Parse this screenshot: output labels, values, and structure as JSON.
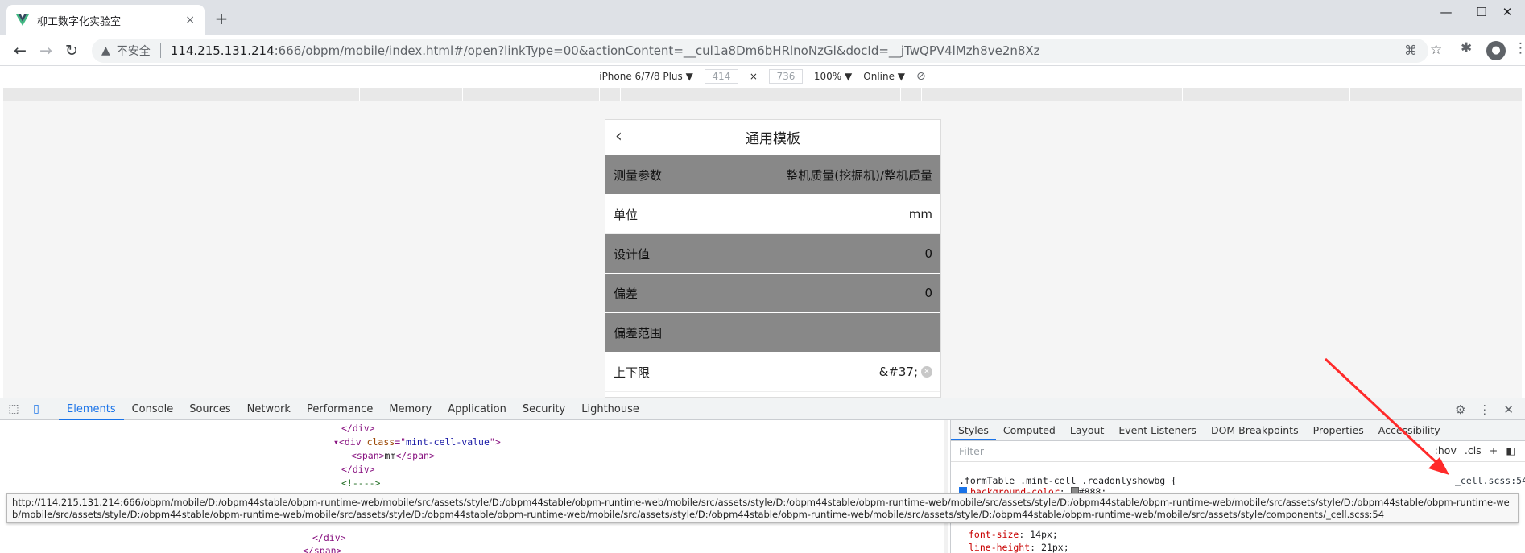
{
  "browser": {
    "tab_title": "柳工数字化实验室",
    "tab_close": "×",
    "new_tab": "+",
    "win_min": "—",
    "win_max": "☐",
    "win_close": "✕",
    "insecure_label": "不安全",
    "url_host": "114.215.131.214",
    "url_rest": ":666/obpm/mobile/index.html#/open?linkType=00&actionContent=__cul1a8Dm6bHRlnoNzGl&docId=__jTwQPV4lMzh8ve2n8Xz"
  },
  "device_toolbar": {
    "device": "iPhone 6/7/8 Plus ▼",
    "width": "414",
    "times": "×",
    "height": "736",
    "zoom": "100% ▼",
    "network": "Online ▼"
  },
  "page": {
    "title": "通用模板",
    "rows": [
      {
        "label": "测量参数",
        "value": "整机质量(挖掘机)/整机质量"
      },
      {
        "label": "单位",
        "value": "mm"
      },
      {
        "label": "设计值",
        "value": "0"
      },
      {
        "label": "偏差",
        "value": "0"
      },
      {
        "label": "偏差范围",
        "value": ""
      },
      {
        "label": "上下限",
        "value": "&#37;"
      }
    ]
  },
  "devtools": {
    "tabs": [
      "Elements",
      "Console",
      "Sources",
      "Network",
      "Performance",
      "Memory",
      "Application",
      "Security",
      "Lighthouse"
    ],
    "elements": {
      "line1_close": "</div>",
      "line2_tag_open": "<div ",
      "line2_attr": "class",
      "line2_eq": "=\"",
      "line2_val": "mint-cell-value",
      "line2_end": "\">",
      "line3_open": "<span>",
      "line3_text": "mm",
      "line3_close": "</span>",
      "line4_close": "</div>",
      "line5_comment": "<!---->",
      "line6_close": "</div>",
      "line7_close": "</span>"
    },
    "styles_tabs": [
      "Styles",
      "Computed",
      "Layout",
      "Event Listeners",
      "DOM Breakpoints",
      "Properties",
      "Accessibility"
    ],
    "filter_placeholder": "Filter",
    "filter_hov": ":hov",
    "filter_cls": ".cls",
    "filter_plus": "+",
    "selector": ".formTable .mint-cell .readonlyshowbg {",
    "source": "_cell.scss:54",
    "prop_bg": "background-color",
    "prop_bg_val": "#888;",
    "prop_fs": "font-size",
    "prop_fs_val": "14px;",
    "prop_lh": "line-height",
    "prop_lh_val": "21px;",
    "tooltip": "http://114.215.131.214:666/obpm/mobile/D:/obpm44stable/obpm-runtime-web/mobile/src/assets/style/D:/obpm44stable/obpm-runtime-web/mobile/src/assets/style/D:/obpm44stable/obpm-runtime-web/mobile/src/assets/style/D:/obpm44stable/obpm-runtime-web/mobile/src/assets/style/D:/obpm44stable/obpm-runtime-web/mobile/src/assets/style/D:/obpm44stable/obpm-runtime-web/mobile/src/assets/style/D:/obpm44stable/obpm-runtime-web/mobile/src/assets/style/D:/obpm44stable/obpm-runtime-web/mobile/src/assets/style/D:/obpm44stable/obpm-runtime-web/mobile/src/assets/style/components/_cell.scss:54"
  },
  "colors": {
    "gray_row": "#888888",
    "accent": "#1a73e8",
    "arrow": "#ff2a2a"
  }
}
